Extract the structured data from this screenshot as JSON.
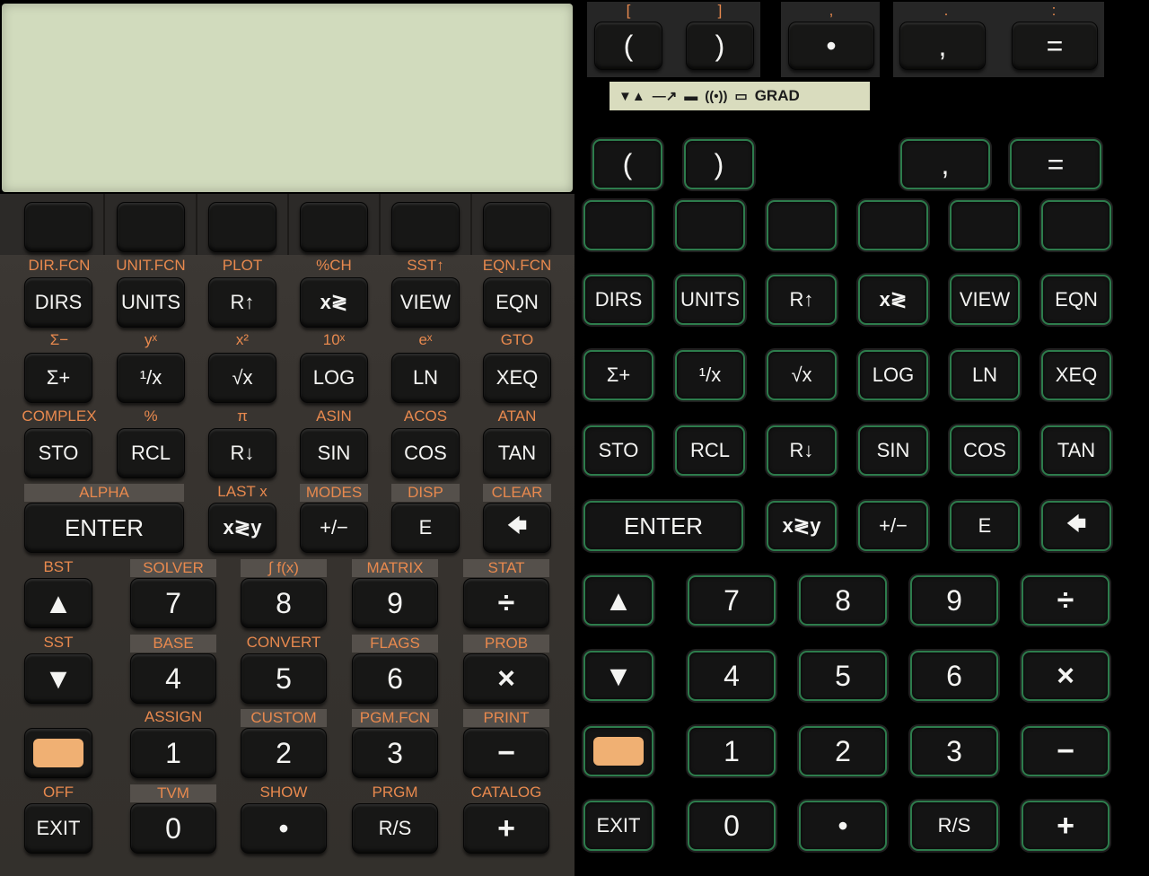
{
  "top_panel": {
    "keys": [
      {
        "name": "lparen",
        "label": "(",
        "shift": "["
      },
      {
        "name": "rparen",
        "label": ")",
        "shift": "]"
      },
      {
        "name": "dot",
        "label": "•",
        "shift": ","
      },
      {
        "name": "comma",
        "label": ",",
        "shift": "."
      },
      {
        "name": "equals",
        "label": "=",
        "shift": ":"
      }
    ]
  },
  "annunciator": {
    "icons": [
      "▼▲",
      "—↗",
      "▬",
      "((•))",
      "▭"
    ],
    "mode": "GRAD"
  },
  "shift_labels": {
    "row1": [
      "DIR.FCN",
      "UNIT.FCN",
      "PLOT",
      "%CH",
      "SST↑",
      "EQN.FCN"
    ],
    "row2": [
      "Σ−",
      "yˣ",
      "x²",
      "10ˣ",
      "eˣ",
      "GTO"
    ],
    "row3": [
      "COMPLEX",
      "%",
      "π",
      "ASIN",
      "ACOS",
      "ATAN"
    ],
    "row4": [
      "ALPHA",
      "LAST x",
      "MODES",
      "DISP",
      "CLEAR"
    ],
    "row5": [
      "BST",
      "SOLVER",
      "∫ f(x)",
      "MATRIX",
      "STAT"
    ],
    "row6": [
      "SST",
      "BASE",
      "CONVERT",
      "FLAGS",
      "PROB"
    ],
    "row7": [
      "",
      "ASSIGN",
      "CUSTOM",
      "PGM.FCN",
      "PRINT"
    ],
    "row8": [
      "OFF",
      "TVM",
      "SHOW",
      "PRGM",
      "CATALOG"
    ]
  },
  "keys": {
    "row1": [
      "DIRS",
      "UNITS",
      "R↑",
      "x≷",
      "VIEW",
      "EQN"
    ],
    "row2": [
      "Σ+",
      "¹/x",
      "√x",
      "LOG",
      "LN",
      "XEQ"
    ],
    "row3": [
      "STO",
      "RCL",
      "R↓",
      "SIN",
      "COS",
      "TAN"
    ],
    "row4": [
      "ENTER",
      "x≷y",
      "+/−",
      "E",
      "🡄"
    ],
    "row5": [
      "▲",
      "7",
      "8",
      "9",
      "÷"
    ],
    "row6": [
      "▼",
      "4",
      "5",
      "6",
      "×"
    ],
    "row7": [
      "",
      "1",
      "2",
      "3",
      "−"
    ],
    "row8": [
      "EXIT",
      "0",
      "•",
      "R/S",
      "+"
    ]
  }
}
